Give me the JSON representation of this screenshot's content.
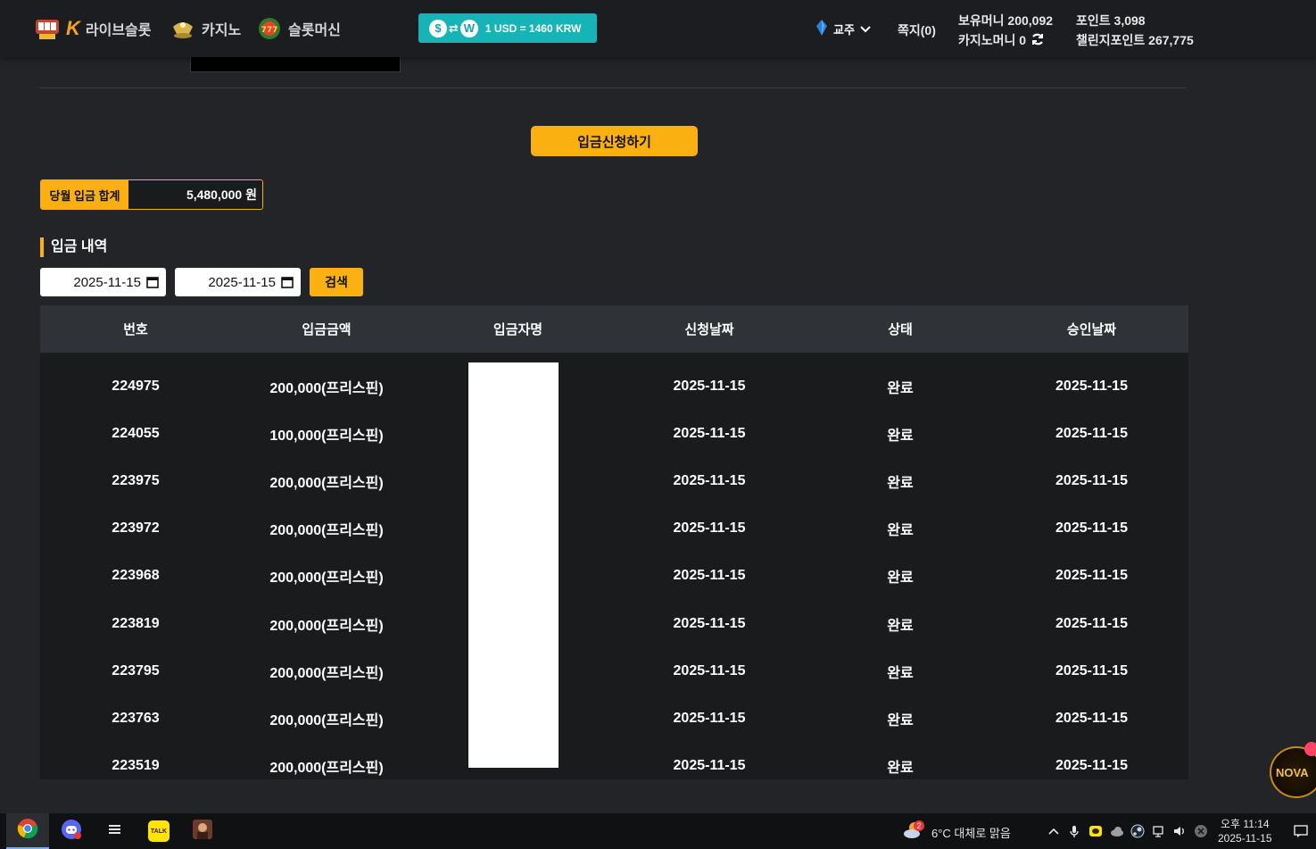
{
  "header": {
    "nav": [
      {
        "label": "라이브슬롯",
        "icon": "slot-machine-icon"
      },
      {
        "label": "카지노",
        "icon": "casino-icon"
      },
      {
        "label": "슬롯머신",
        "icon": "slot-777-icon"
      }
    ],
    "rate_badge": {
      "coin_1": "$",
      "coin_2": "W",
      "text": "1 USD = 1460 KRW"
    },
    "username": "교주",
    "messages": "쪽지(0)",
    "balance_money": "보유머니 200,092",
    "casino_money": "카지노머니 0",
    "points": "포인트 3,098",
    "challenge_points": "챌린지포인트 267,775"
  },
  "deposit": {
    "apply_button": "입금신청하기",
    "monthly_total_label": "당월 입금 합계",
    "monthly_total_value": "5,480,000 원",
    "section_title": "입금 내역",
    "date_from": "2025-11-15",
    "date_to": "2025-11-15",
    "search_button": "검색",
    "columns": [
      "번호",
      "입금금액",
      "입금자명",
      "신청날짜",
      "상태",
      "승인날짜"
    ],
    "rows": [
      {
        "no": "224975",
        "amount": "200,000(프리스핀)",
        "depositor": "",
        "applied": "2025-11-15",
        "status": "완료",
        "approved": "2025-11-15"
      },
      {
        "no": "224055",
        "amount": "100,000(프리스핀)",
        "depositor": "",
        "applied": "2025-11-15",
        "status": "완료",
        "approved": "2025-11-15"
      },
      {
        "no": "223975",
        "amount": "200,000(프리스핀)",
        "depositor": "",
        "applied": "2025-11-15",
        "status": "완료",
        "approved": "2025-11-15"
      },
      {
        "no": "223972",
        "amount": "200,000(프리스핀)",
        "depositor": "",
        "applied": "2025-11-15",
        "status": "완료",
        "approved": "2025-11-15"
      },
      {
        "no": "223968",
        "amount": "200,000(프리스핀)",
        "depositor": "",
        "applied": "2025-11-15",
        "status": "완료",
        "approved": "2025-11-15"
      },
      {
        "no": "223819",
        "amount": "200,000(프리스핀)",
        "depositor": "",
        "applied": "2025-11-15",
        "status": "완료",
        "approved": "2025-11-15"
      },
      {
        "no": "223795",
        "amount": "200,000(프리스핀)",
        "depositor": "",
        "applied": "2025-11-15",
        "status": "완료",
        "approved": "2025-11-15"
      },
      {
        "no": "223763",
        "amount": "200,000(프리스핀)",
        "depositor": "",
        "applied": "2025-11-15",
        "status": "완료",
        "approved": "2025-11-15"
      },
      {
        "no": "223519",
        "amount": "200,000(프리스핀)",
        "depositor": "",
        "applied": "2025-11-15",
        "status": "완료",
        "approved": "2025-11-15"
      }
    ]
  },
  "floating_widget": {
    "label": "NOVA"
  },
  "taskbar": {
    "apps": [
      "chrome-icon",
      "discord-icon",
      "app-icon",
      "kakaotalk-icon",
      "game-icon"
    ],
    "kakaotalk_label": "TALK",
    "weather_badge": "2",
    "weather": "6°C  대체로 맑음",
    "clock_ampm_time": "오후 11:14",
    "clock_date": "2025-11-15"
  },
  "colors": {
    "accent": "#fbb012",
    "background": "#222427",
    "table_header": "#2f3236",
    "rate_badge": "#17b4b7"
  }
}
